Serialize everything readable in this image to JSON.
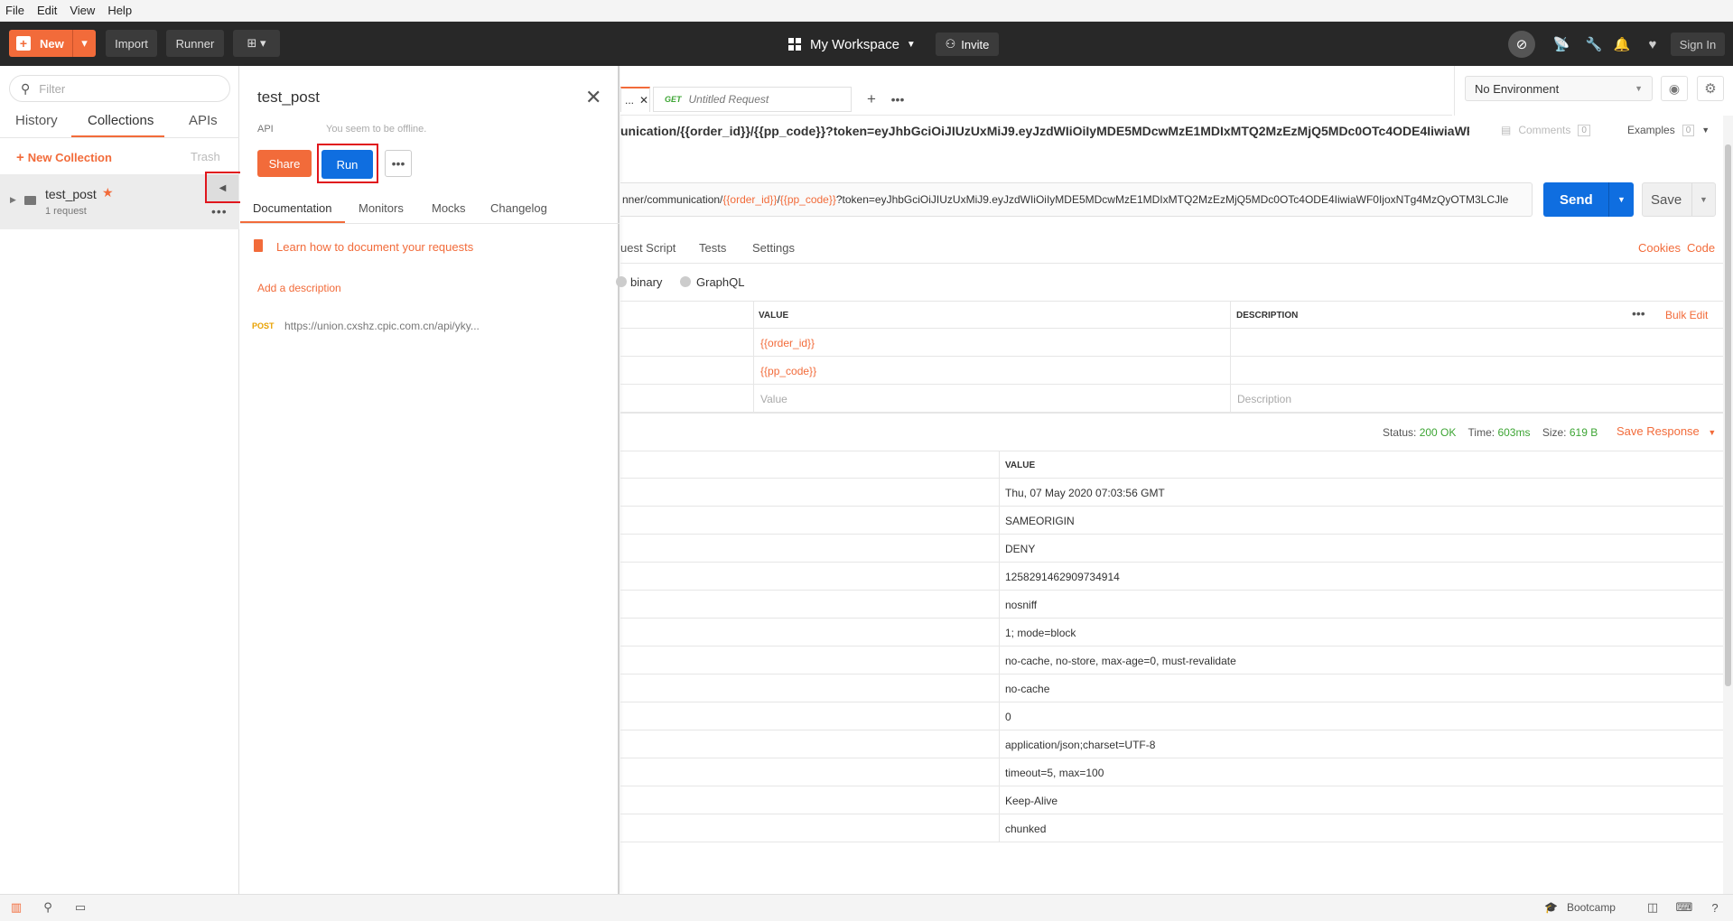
{
  "menu": [
    "File",
    "Edit",
    "View",
    "Help"
  ],
  "toolbar": {
    "new_label": "New",
    "import_label": "Import",
    "runner_label": "Runner",
    "workspace_label": "My Workspace",
    "invite_label": "Invite",
    "signin_label": "Sign In"
  },
  "sidebar": {
    "filter_placeholder": "Filter",
    "tabs": [
      "History",
      "Collections",
      "APIs"
    ],
    "active_tab": "Collections",
    "new_collection_label": "New Collection",
    "trash_label": "Trash",
    "collection": {
      "name": "test_post",
      "count": "1 request"
    }
  },
  "panel": {
    "title": "test_post",
    "type_label": "API",
    "offline_text": "You seem to be offline.",
    "share_label": "Share",
    "run_label": "Run",
    "tabs": [
      "Documentation",
      "Monitors",
      "Mocks",
      "Changelog"
    ],
    "learn_link": "Learn how to document your requests",
    "add_description": "Add a description",
    "request": {
      "method": "POST",
      "url": "https://union.cxshz.cpic.com.cn/api/yky..."
    }
  },
  "request_tabs": {
    "tab1_label": "...",
    "tab2_method": "GET",
    "tab2_label": "Untitled Request"
  },
  "environment": {
    "selected": "No Environment"
  },
  "request": {
    "name": "unication/{{order_id}}/{{pp_code}}?token=eyJhbGciOiJIUzUxMiJ9.eyJzdWIiOiIyMDE5MDcwMzE1MDIxMTQ2MzEzMjQ5MDc0OTc4ODE4IiwiaWF0IjoxNTg4...",
    "comments_label": "Comments",
    "comments_count": "0",
    "examples_label": "Examples",
    "examples_count": "0",
    "url_prefix": "nner/communication/",
    "url_var1": "{{order_id}}",
    "url_slash": "/",
    "url_var2": "{{pp_code}}",
    "url_suffix": "?token=eyJhbGciOiJIUzUxMiJ9.eyJzdWIiOiIyMDE5MDcwMzE1MDIxMTQ2MzEzMjQ5MDc0OTc4ODE4IiwiaWF0IjoxNTg4MzQyOTM3LCJle",
    "send_label": "Send",
    "save_label": "Save"
  },
  "req_subtabs": [
    "uest Script",
    "Tests",
    "Settings"
  ],
  "cookies_label": "Cookies",
  "code_label": "Code",
  "body_types": [
    "binary",
    "GraphQL"
  ],
  "params_table": {
    "headers": [
      "VALUE",
      "DESCRIPTION"
    ],
    "bulk_edit": "Bulk Edit",
    "rows": [
      {
        "value": "{{order_id}}",
        "description": ""
      },
      {
        "value": "{{pp_code}}",
        "description": ""
      }
    ],
    "value_placeholder": "Value",
    "description_placeholder": "Description"
  },
  "response": {
    "status_label": "Status:",
    "status_value": "200 OK",
    "time_label": "Time:",
    "time_value": "603ms",
    "size_label": "Size:",
    "size_value": "619 B",
    "save_response": "Save Response",
    "value_header": "VALUE",
    "values": [
      "Thu, 07 May 2020 07:03:56 GMT",
      "SAMEORIGIN",
      "DENY",
      "1258291462909734914",
      "nosniff",
      "1; mode=block",
      "no-cache, no-store, max-age=0, must-revalidate",
      "no-cache",
      "0",
      "application/json;charset=UTF-8",
      "timeout=5, max=100",
      "Keep-Alive",
      "chunked"
    ]
  },
  "statusbar": {
    "bootcamp_label": "Bootcamp"
  },
  "colors": {
    "accent": "#f26b3a",
    "primary": "#0f6ee0",
    "toolbar_bg": "#282828",
    "success": "#3da534"
  }
}
